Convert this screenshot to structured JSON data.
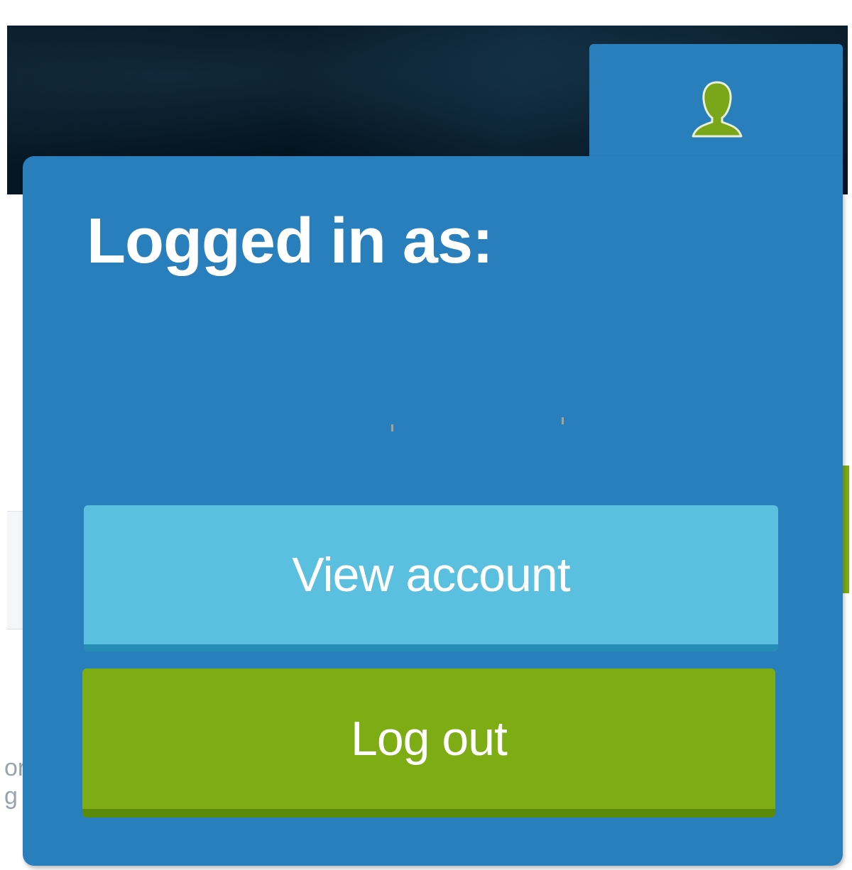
{
  "account_menu": {
    "tab_icon": "user-icon",
    "logged_in_label": "Logged in as:",
    "view_account_label": "View account",
    "logout_label": "Log out"
  },
  "colors": {
    "panel_blue": "#287fbb",
    "view_account_button": "#5bbfe0",
    "logout_button": "#7dac14",
    "user_icon_green": "#7aa61a",
    "header_dark": "#041420"
  }
}
